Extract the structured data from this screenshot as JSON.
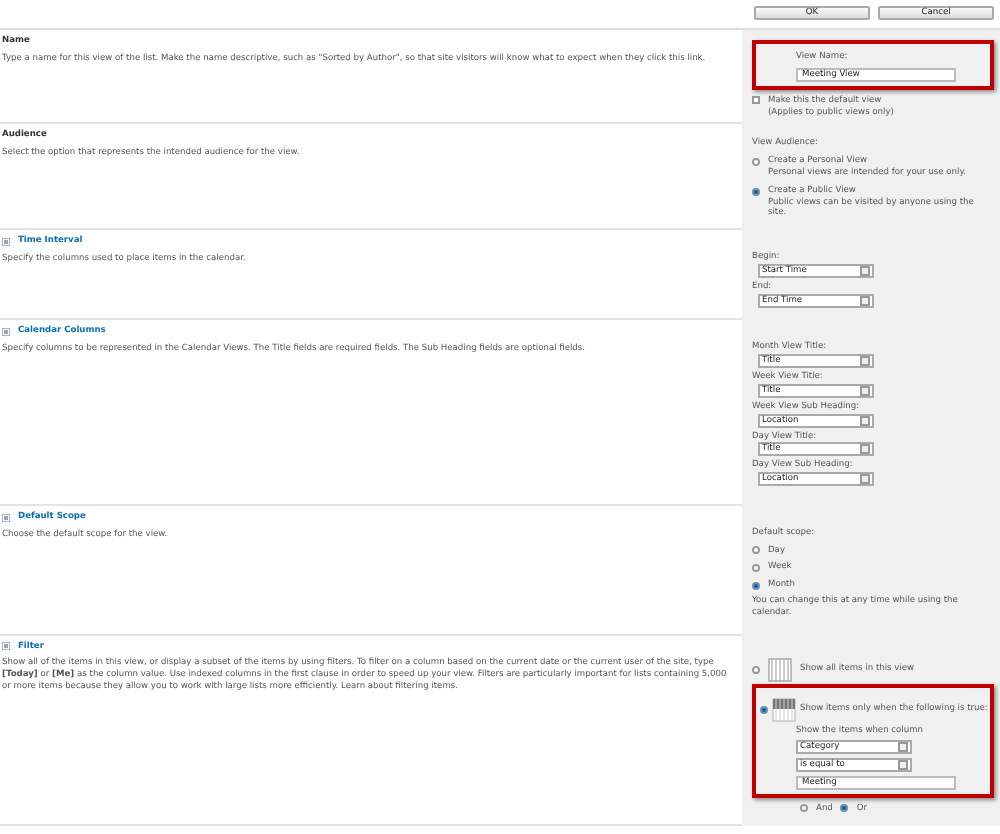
{
  "buttons": [
    {
      "label": "OK"
    },
    {
      "label": "Cancel"
    }
  ],
  "sections": [
    {
      "kind": "plain",
      "title": "Name",
      "description": "Type a name for this view of the list. Make the name descriptive, such as \"Sorted by Author\", so that site visitors will know what to expect when they click this link.",
      "controls": [
        {
          "kind": "frame",
          "highlighted": true,
          "items": [
            {
              "kind": "label",
              "text": "View Name:"
            },
            {
              "kind": "input",
              "value": "Meeting View"
            }
          ]
        },
        {
          "kind": "checkbox",
          "label": "Make this the default view",
          "note": "(Applies to public views only)",
          "checked": false
        }
      ]
    },
    {
      "kind": "plain",
      "title": "Audience",
      "description": "Select the option that represents the intended audience for the view.",
      "controls": [
        {
          "kind": "label",
          "text": "View Audience:"
        },
        {
          "kind": "radio",
          "label": "Create a Personal View",
          "note": "Personal views are intended for your use only.",
          "selected": false
        },
        {
          "kind": "radio",
          "label": "Create a Public View",
          "note": "Public views can be visited by anyone using the site.",
          "selected": true
        }
      ]
    },
    {
      "kind": "collapsible",
      "title": "Time Interval",
      "description": "Specify the columns used to place items in the calendar.",
      "controls": [
        {
          "kind": "label",
          "text": "Begin:"
        },
        {
          "kind": "select",
          "value": "Start Time"
        },
        {
          "kind": "label",
          "text": "End:"
        },
        {
          "kind": "select",
          "value": "End Time"
        }
      ]
    },
    {
      "kind": "collapsible",
      "title": "Calendar Columns",
      "description": "Specify columns to be represented in the Calendar Views. The Title fields are required fields. The Sub Heading fields are optional fields.",
      "controls": [
        {
          "kind": "label",
          "text": "Month View Title:"
        },
        {
          "kind": "select",
          "value": "Title"
        },
        {
          "kind": "label",
          "text": "Week View Title:"
        },
        {
          "kind": "select",
          "value": "Title"
        },
        {
          "kind": "label",
          "text": "Week View Sub Heading:"
        },
        {
          "kind": "select",
          "value": "Location"
        },
        {
          "kind": "label",
          "text": "Day View Title:"
        },
        {
          "kind": "select",
          "value": "Title"
        },
        {
          "kind": "label",
          "text": "Day View Sub Heading:"
        },
        {
          "kind": "select",
          "value": "Location"
        }
      ]
    },
    {
      "kind": "collapsible",
      "title": "Default Scope",
      "description": "Choose the default scope for the view.",
      "controls": [
        {
          "kind": "label",
          "text": "Default scope:"
        },
        {
          "kind": "radio",
          "label": "Day",
          "selected": false
        },
        {
          "kind": "radio",
          "label": "Week",
          "selected": false
        },
        {
          "kind": "radio",
          "label": "Month",
          "selected": true
        },
        {
          "kind": "note",
          "text": "You can change this at any time while using the calendar."
        }
      ]
    },
    {
      "kind": "collapsible",
      "title": "Filter",
      "description": "Show all of the items in this view, or display a subset of the items by using filters. To filter on a column based on the current date or the current user of the site, type **[Today]** or **[Me]** as the column value. Use indexed columns in the first clause in order to speed up your view. Filters are particularly important for lists containing 5,000 or more items because they allow you to work with large lists more efficiently.",
      "link": "Learn about filtering items.",
      "controls": [
        {
          "kind": "gridradio",
          "label": "Show all items in this view",
          "selected": false
        },
        {
          "kind": "frame",
          "highlighted": true,
          "items": [
            {
              "kind": "filterradio",
              "label": "Show items only when the following is true:",
              "selected": true
            },
            {
              "kind": "label",
              "text": "Show the items when column"
            },
            {
              "kind": "select",
              "value": "Category"
            },
            {
              "kind": "select",
              "value": "is equal to"
            },
            {
              "kind": "input",
              "value": "Meeting"
            }
          ]
        },
        {
          "kind": "inline_radios",
          "options": [
            {
              "label": "And",
              "selected": false
            },
            {
              "label": "Or",
              "selected": true
            }
          ]
        }
      ]
    }
  ]
}
